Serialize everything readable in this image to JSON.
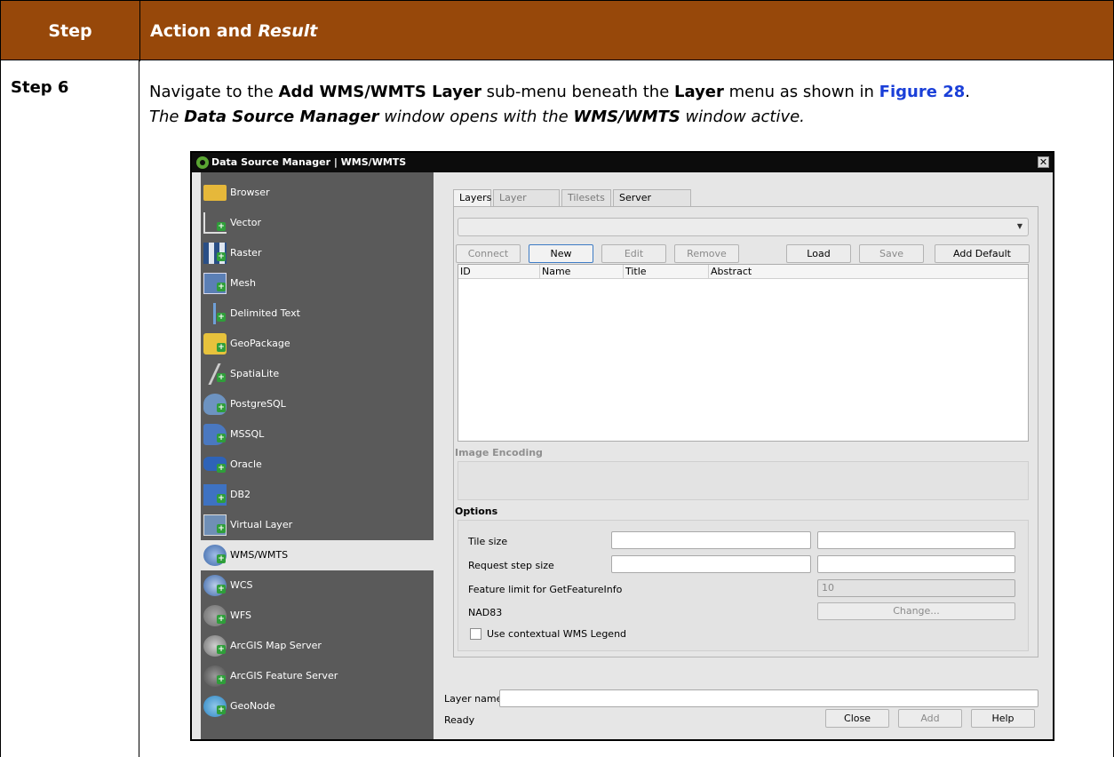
{
  "table": {
    "header_step": "Step",
    "header_action_plain": "Action and ",
    "header_action_italic": "Result",
    "step_label": "Step 6",
    "instruction": {
      "p1": "Navigate to the ",
      "b1": "Add WMS/WMTS Layer",
      "p2": " sub-menu beneath the ",
      "b2": "Layer",
      "p3": " menu as shown in ",
      "link": "Figure 28",
      "p4": ".",
      "i1": "The ",
      "ib1": "Data Source Manager",
      "i2": " window opens with the ",
      "ib2": "WMS/WMTS",
      "i3": " window active."
    }
  },
  "window": {
    "title": "Data Source Manager | WMS/WMTS",
    "close_glyph": "✕"
  },
  "sidebar": {
    "items": [
      {
        "label": "Browser",
        "icon": "folder-icon"
      },
      {
        "label": "Vector",
        "icon": "vector-icon"
      },
      {
        "label": "Raster",
        "icon": "raster-icon"
      },
      {
        "label": "Mesh",
        "icon": "mesh-icon"
      },
      {
        "label": "Delimited Text",
        "icon": "delimited-text-icon"
      },
      {
        "label": "GeoPackage",
        "icon": "geopackage-icon"
      },
      {
        "label": "SpatiaLite",
        "icon": "spatialite-icon"
      },
      {
        "label": "PostgreSQL",
        "icon": "postgresql-icon"
      },
      {
        "label": "MSSQL",
        "icon": "mssql-icon"
      },
      {
        "label": "Oracle",
        "icon": "oracle-icon"
      },
      {
        "label": "DB2",
        "icon": "db2-icon"
      },
      {
        "label": "Virtual Layer",
        "icon": "virtual-layer-icon"
      },
      {
        "label": "WMS/WMTS",
        "icon": "wms-icon",
        "active": true
      },
      {
        "label": "WCS",
        "icon": "wcs-icon"
      },
      {
        "label": "WFS",
        "icon": "wfs-icon"
      },
      {
        "label": "ArcGIS Map Server",
        "icon": "arcgis-map-server-icon"
      },
      {
        "label": "ArcGIS Feature Server",
        "icon": "arcgis-feature-server-icon"
      },
      {
        "label": "GeoNode",
        "icon": "geonode-icon"
      }
    ]
  },
  "tabs": [
    "Layers",
    "Layer Order",
    "Tilesets",
    "Server Search"
  ],
  "buttons": {
    "connect": "Connect",
    "new": "New",
    "edit": "Edit",
    "remove": "Remove",
    "load": "Load",
    "save": "Save",
    "add_default": "Add Default Servers"
  },
  "grid_columns": [
    "ID",
    "Name",
    "Title",
    "Abstract"
  ],
  "image_encoding_label": "Image Encoding",
  "options": {
    "title": "Options",
    "tile_size": "Tile size",
    "request_step": "Request step size",
    "feature_limit": "Feature limit for GetFeatureInfo",
    "feature_limit_value": "10",
    "crs": "NAD83",
    "change": "Change...",
    "contextual_legend": "Use contextual WMS Legend"
  },
  "layer_name_label": "Layer name",
  "status": "Ready",
  "footer_buttons": {
    "close": "Close",
    "add": "Add",
    "help": "Help"
  },
  "colors": {
    "header_bg": "#97480a",
    "link": "#1a3fd8",
    "sidebar_bg": "#5a5a5a"
  }
}
